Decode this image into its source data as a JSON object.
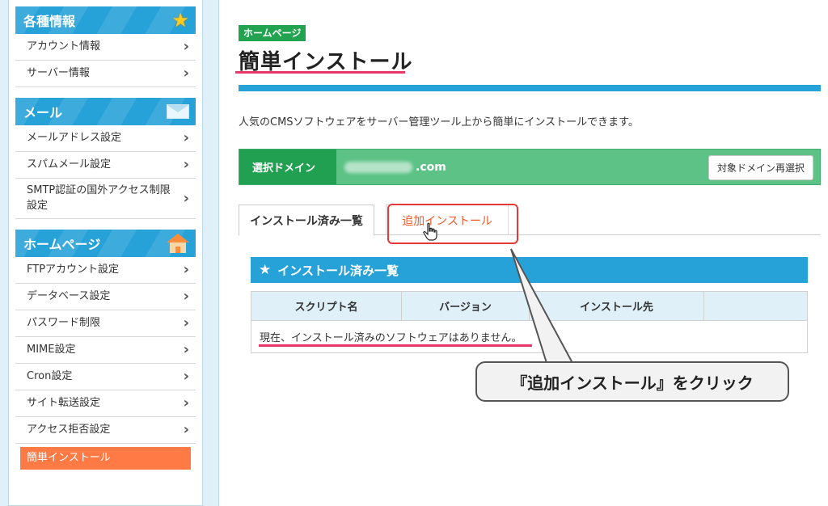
{
  "sidebar": {
    "sections": [
      {
        "title": "各種情報",
        "icon": "star-icon",
        "items": [
          "アカウント情報",
          "サーバー情報"
        ]
      },
      {
        "title": "メール",
        "icon": "mail-icon",
        "items": [
          "メールアドレス設定",
          "スパムメール設定",
          "SMTP認証の国外アクセス制限設定"
        ]
      },
      {
        "title": "ホームページ",
        "icon": "house-icon",
        "items": [
          "FTPアカウント設定",
          "データベース設定",
          "パスワード制限",
          "MIME設定",
          "Cron設定",
          "サイト転送設定",
          "アクセス拒否設定",
          "簡単インストール"
        ]
      }
    ],
    "active_item": "簡単インストール",
    "chevron": "›",
    "colors": {
      "section_bg": "#27a2d8",
      "active_bg": "#ff7a44"
    }
  },
  "main": {
    "badge": "ホームページ",
    "title": "簡単インストール",
    "description": "人気のCMSソフトウェアをサーバー管理ツール上から簡単にインストールできます。",
    "domain": {
      "label": "選択ドメイン",
      "suffix": ".com",
      "button": "対象ドメイン再選択"
    },
    "tabs": [
      {
        "label": "インストール済み一覧",
        "active": true
      },
      {
        "label": "追加インストール",
        "active": false
      }
    ],
    "list": {
      "header": "インストール済み一覧",
      "columns": [
        "スクリプト名",
        "バージョン",
        "インストール先",
        ""
      ],
      "empty_message": "現在、インストール済みのソフトウェアはありません。"
    }
  },
  "callout": {
    "text": "『追加インストール』をクリック"
  },
  "colors": {
    "accent_blue": "#27a2d8",
    "green": "#22a052",
    "highlight_red": "#e53935",
    "underline_pink": "#e8386a",
    "tab_link": "#f05a28"
  }
}
